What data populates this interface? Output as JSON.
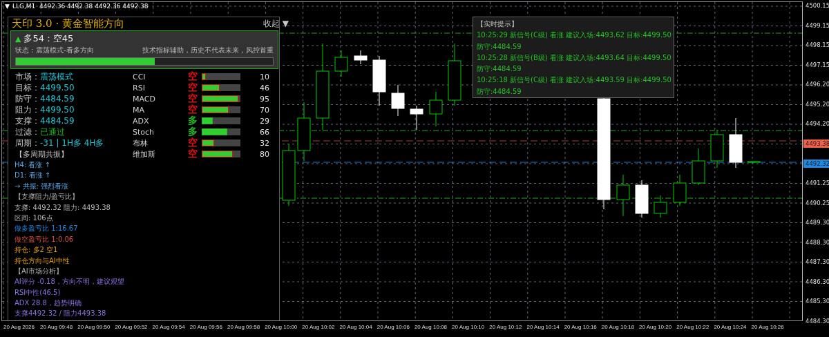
{
  "chart_header": {
    "menu_icon": "▼",
    "symbol_info": "LLG,M1  4492.36 4492.38 4492.36 4492.38"
  },
  "panel": {
    "title": "天印 3.0 · 黄金智能方向",
    "collapse_button": "收起 ▼",
    "summary": {
      "arrow": "▲",
      "score": "多54 : 空45",
      "status": "状态：震荡模式-看多方向",
      "disclaimer": "技术指标辅助，历史不代表未来，风控首重",
      "level": 0.54
    },
    "rows": [
      {
        "kind": "field",
        "label": "市场：",
        "value": "震荡模式"
      },
      {
        "kind": "field",
        "label": "目标：",
        "value": "4499.50"
      },
      {
        "kind": "field",
        "label": "防守：",
        "value": "4484.59"
      },
      {
        "kind": "field",
        "label": "阻力：",
        "value": "4499.50"
      },
      {
        "kind": "field",
        "label": "支撑：",
        "value": "4484.59"
      },
      {
        "kind": "passed",
        "label": "过滤：",
        "value": "已通过"
      },
      {
        "kind": "field",
        "label": "周期：",
        "value": "-31 | 1H多  4H多"
      },
      {
        "kind": "heading",
        "label": "【多周期共振】"
      }
    ],
    "indicators": [
      {
        "name": "CCI",
        "signal": "空",
        "color": "#e01010",
        "level": 0.1,
        "value": "10"
      },
      {
        "name": "RSI",
        "signal": "空",
        "color": "#e01010",
        "level": 0.46,
        "value": "46"
      },
      {
        "name": "MACD",
        "signal": "空",
        "color": "#e01010",
        "level": 0.95,
        "value": "95"
      },
      {
        "name": "MA",
        "signal": "空",
        "color": "#e01010",
        "level": 0.7,
        "value": "70"
      },
      {
        "name": "ADX",
        "signal": "多",
        "color": "#22b822",
        "level": 0.29,
        "value": "29"
      },
      {
        "name": "Stoch",
        "signal": "多",
        "color": "#22b822",
        "level": 0.66,
        "value": "66"
      },
      {
        "name": "布林",
        "signal": "空",
        "color": "#e01010",
        "level": 0.32,
        "value": "32"
      },
      {
        "name": "维加斯",
        "signal": "空",
        "color": "#e01010",
        "level": 0.8,
        "value": "80"
      }
    ],
    "notes": [
      {
        "kind": "trend",
        "text": "H4: 看涨 ↑"
      },
      {
        "kind": "trend",
        "text": "D1: 看涨 ↑"
      },
      {
        "kind": "trend",
        "text": "→ 共振: 强烈看涨"
      },
      {
        "kind": "plain",
        "text": "【支撑阻力/盈亏比】"
      },
      {
        "kind": "plain",
        "text": "支撑: 4492.32  阻力: 4493.38"
      },
      {
        "kind": "plain",
        "text": "区间: 106点"
      },
      {
        "kind": "long",
        "text": "做多盈亏比 1:16.67"
      },
      {
        "kind": "short",
        "text": "做空盈亏比 1:0.06"
      },
      {
        "kind": "position",
        "text": "持仓: 多2 空1"
      },
      {
        "kind": "position",
        "text": "持仓方向与AI中性"
      },
      {
        "kind": "plain",
        "text": "【AI市场分析】"
      },
      {
        "kind": "ai",
        "text": "AI评分 -0.18，方向不明，建议观望"
      },
      {
        "kind": "ai",
        "text": "RSI中性(46.5)"
      },
      {
        "kind": "ai",
        "text": "ADX 28.8，趋势明确"
      },
      {
        "kind": "ai",
        "text": "支撑4492.32 / 阻力4493.38"
      }
    ]
  },
  "alerts": {
    "title": "【实时提示】",
    "lines": [
      "10:25:29 新信号(C级) 看涨 建议入场:4493.62 目标:4499.50",
      "防守:4484.59",
      "10:25:28 新信号(B级) 看涨 建议入场:4493.64 目标:4499.50",
      "防守:4484.59",
      "10:25:18 新信号(C级) 看涨 建议入场:4493.59 目标:4499.50",
      "防守:4484.59"
    ]
  },
  "price_axis": {
    "labels": [
      {
        "kind": "tick",
        "text": "4500.15"
      },
      {
        "kind": "tick",
        "text": "4499.15"
      },
      {
        "kind": "tick",
        "text": "4498.15"
      },
      {
        "kind": "tick",
        "text": "4497.15"
      },
      {
        "kind": "tick",
        "text": "4496.20"
      },
      {
        "kind": "tick",
        "text": "4495.20"
      },
      {
        "kind": "tick",
        "text": "4494.20"
      },
      {
        "kind": "marker",
        "text": "4493.38",
        "color": "#f0604a"
      },
      {
        "kind": "marker",
        "text": "4492.32",
        "color": "#1e88e5"
      },
      {
        "kind": "tick",
        "text": "4491.25"
      },
      {
        "kind": "tick",
        "text": "4490.25"
      },
      {
        "kind": "tick",
        "text": "4489.30"
      },
      {
        "kind": "tick",
        "text": "4488.30"
      },
      {
        "kind": "tick",
        "text": "4487.30"
      },
      {
        "kind": "tick",
        "text": "4486.30"
      },
      {
        "kind": "tick",
        "text": "4485.30"
      },
      {
        "kind": "tick",
        "text": "4484.30"
      }
    ]
  },
  "time_axis": {
    "labels": [
      "20 Aug 2026",
      "20 Aug 09:48",
      "20 Aug 09:50",
      "20 Aug 09:52",
      "20 Aug 09:54",
      "20 Aug 09:56",
      "20 Aug 09:58",
      "20 Aug 10:00",
      "20 Aug 10:02",
      "20 Aug 10:04",
      "20 Aug 10:06",
      "20 Aug 10:08",
      "20 Aug 10:10",
      "20 Aug 10:12",
      "20 Aug 10:14",
      "20 Aug 10:16",
      "20 Aug 10:18",
      "20 Aug 10:20",
      "20 Aug 10:22",
      "20 Aug 10:24",
      "20 Aug 10:26"
    ]
  }
}
